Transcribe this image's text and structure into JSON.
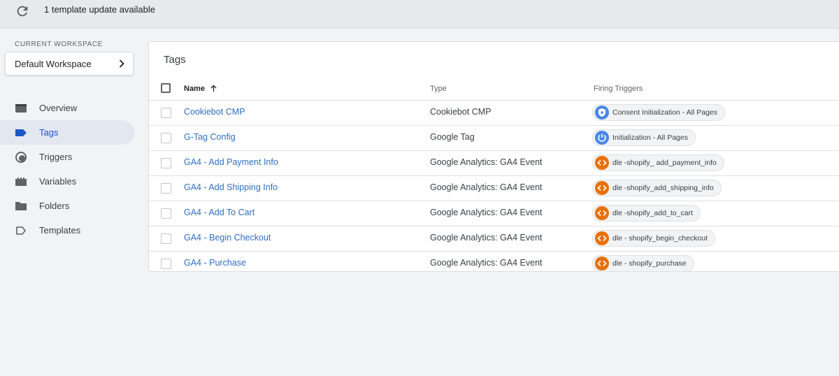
{
  "topbar": {
    "update_text": "1 template update available"
  },
  "workspace": {
    "label": "CURRENT WORKSPACE",
    "name": "Default Workspace"
  },
  "nav": {
    "items": [
      {
        "label": "Overview",
        "icon": "overview-icon"
      },
      {
        "label": "Tags",
        "icon": "tag-icon",
        "active": true
      },
      {
        "label": "Triggers",
        "icon": "trigger-icon"
      },
      {
        "label": "Variables",
        "icon": "variables-icon"
      },
      {
        "label": "Folders",
        "icon": "folder-icon"
      },
      {
        "label": "Templates",
        "icon": "template-icon"
      }
    ]
  },
  "panel": {
    "title": "Tags",
    "columns": {
      "name": "Name",
      "type": "Type",
      "triggers": "Firing Triggers"
    },
    "rows": [
      {
        "name": "Cookiebot CMP",
        "type": "Cookiebot CMP",
        "trigger": "Consent Initialization - All Pages",
        "trigger_icon": "consent-shield-icon"
      },
      {
        "name": "G-Tag Config",
        "type": "Google Tag",
        "trigger": "Initialization - All Pages",
        "trigger_icon": "power-icon"
      },
      {
        "name": "GA4 - Add Payment Info",
        "type": "Google Analytics: GA4 Event",
        "trigger": "dle -shopify_ add_payment_info",
        "trigger_icon": "custom-event-icon"
      },
      {
        "name": "GA4 - Add Shipping Info",
        "type": "Google Analytics: GA4 Event",
        "trigger": "dle -shopify_add_shipping_info",
        "trigger_icon": "custom-event-icon"
      },
      {
        "name": "GA4 - Add To Cart",
        "type": "Google Analytics: GA4 Event",
        "trigger": "dle -shopify_add_to_cart",
        "trigger_icon": "custom-event-icon"
      },
      {
        "name": "GA4 - Begin Checkout",
        "type": "Google Analytics: GA4 Event",
        "trigger": "dle - shopify_begin_checkout",
        "trigger_icon": "custom-event-icon"
      },
      {
        "name": "GA4 - Purchase",
        "type": "Google Analytics: GA4 Event",
        "trigger": "dle - shopify_purchase",
        "trigger_icon": "custom-event-icon"
      }
    ]
  },
  "colors": {
    "accent": "#1a73e8",
    "active_nav_bg": "#e2e7f0",
    "consent_icon": "#4a86e8",
    "custom_event_icon": "#e8710a"
  }
}
